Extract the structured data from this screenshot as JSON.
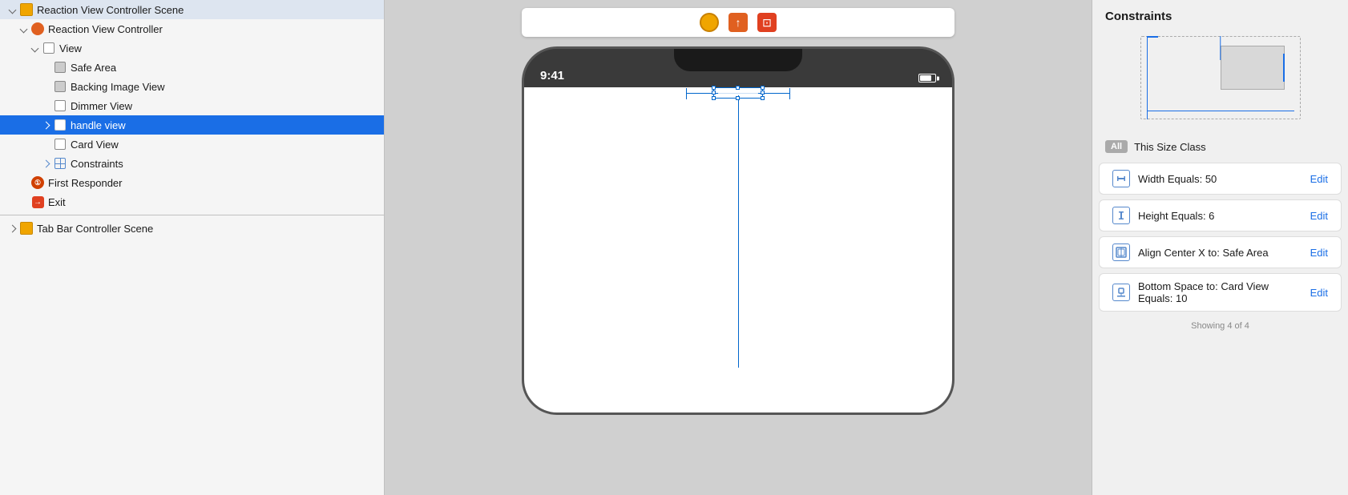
{
  "left_panel": {
    "scene_title": "Reaction View Controller Scene",
    "items": [
      {
        "label": "Reaction View Controller",
        "indent": 1,
        "icon": "orange-circle",
        "toggle": "down",
        "id": "reaction-vc"
      },
      {
        "label": "View",
        "indent": 2,
        "icon": "white-rect",
        "toggle": "down",
        "id": "view"
      },
      {
        "label": "Safe Area",
        "indent": 3,
        "icon": "gray-rect",
        "toggle": null,
        "id": "safe-area"
      },
      {
        "label": "Backing Image View",
        "indent": 3,
        "icon": "gray-rect",
        "toggle": null,
        "id": "backing-image"
      },
      {
        "label": "Dimmer View",
        "indent": 3,
        "icon": "white-rect",
        "toggle": null,
        "id": "dimmer-view"
      },
      {
        "label": "handle view",
        "indent": 3,
        "icon": "white-rect",
        "toggle": "right",
        "selected": true,
        "id": "handle-view"
      },
      {
        "label": "Card View",
        "indent": 3,
        "icon": "white-rect",
        "toggle": null,
        "id": "card-view"
      },
      {
        "label": "Constraints",
        "indent": 3,
        "icon": "grid",
        "toggle": "right",
        "id": "constraints"
      }
    ],
    "other_items": [
      {
        "label": "First Responder",
        "indent": 1,
        "icon": "responder",
        "id": "first-responder"
      },
      {
        "label": "Exit",
        "indent": 1,
        "icon": "exit",
        "id": "exit"
      }
    ],
    "scene2_title": "Tab Bar Controller Scene"
  },
  "toolbar": {
    "icons": [
      "yellow-circle",
      "orange-square",
      "red-exit"
    ]
  },
  "phone": {
    "time": "9:41",
    "battery": true
  },
  "constraints_panel": {
    "title": "Constraints",
    "size_class_label": "This Size Class",
    "all_badge": "All",
    "rows": [
      {
        "label": "Width Equals:  50",
        "edit": "Edit",
        "icon": "width-h"
      },
      {
        "label": "Height Equals:  6",
        "edit": "Edit",
        "icon": "height-v"
      },
      {
        "label": "Align Center X to:  Safe Area",
        "edit": "Edit",
        "icon": "center-x"
      },
      {
        "label": "Bottom Space to:  Card View\nEquals:  10",
        "edit": "Edit",
        "icon": "bottom-space"
      }
    ],
    "showing": "Showing 4 of 4"
  }
}
